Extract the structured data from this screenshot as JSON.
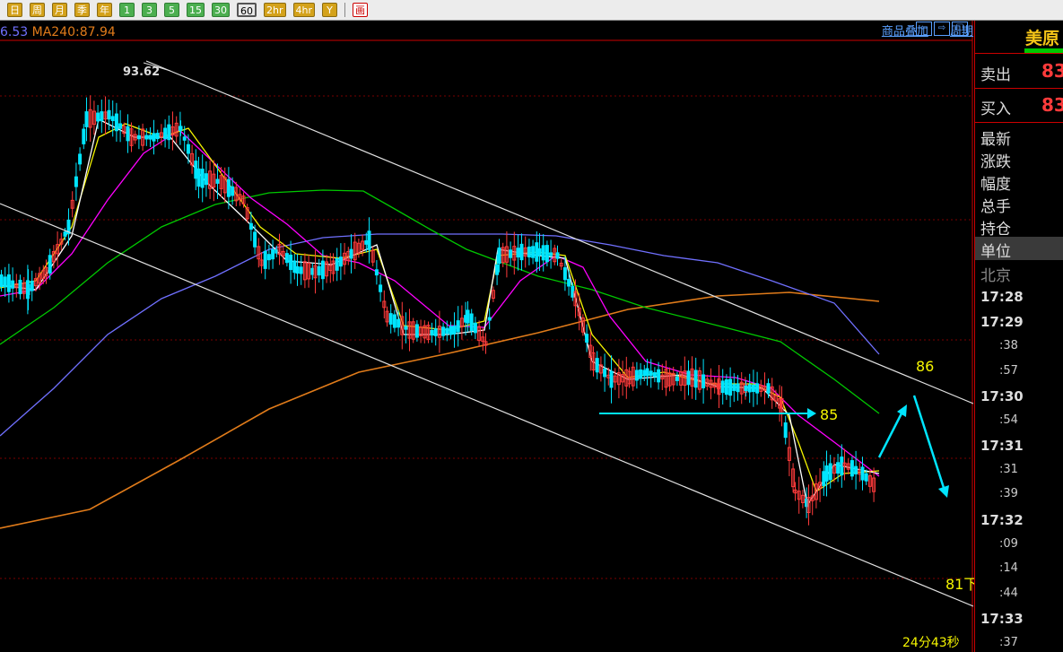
{
  "toolbar": {
    "buttons": [
      "日",
      "周",
      "月",
      "季",
      "年",
      "1",
      "3",
      "5",
      "15",
      "30",
      "60",
      "2hr",
      "4hr",
      "Y"
    ],
    "active": "60"
  },
  "ma_label": {
    "a": "6.53",
    "b": "MA240:87.94"
  },
  "links": {
    "overlay": "商品叠加",
    "period": "周期"
  },
  "nav": [
    "⇦",
    "⇨",
    "☐"
  ],
  "chart_texts": {
    "high": "93.62",
    "t86": "86",
    "t85": "85",
    "t81": "81下",
    "timer": "24分43秒"
  },
  "panel": {
    "title": "美原",
    "sell_label": "卖出",
    "sell_val": "83",
    "buy_label": "买入",
    "buy_val": "83",
    "rows": [
      "最新",
      "涨跌",
      "幅度",
      "总手",
      "持仓"
    ],
    "unit": "单位",
    "city": "北京",
    "times": [
      {
        "t": "17:28",
        "big": true
      },
      {
        "t": "17:29",
        "big": true
      },
      {
        "t": ":38"
      },
      {
        "t": ":57"
      },
      {
        "t": "17:30",
        "big": true
      },
      {
        "t": ":54"
      },
      {
        "t": "17:31",
        "big": true
      },
      {
        "t": ":31"
      },
      {
        "t": ":39"
      },
      {
        "t": "17:32",
        "big": true
      },
      {
        "t": ":09"
      },
      {
        "t": ":14"
      },
      {
        "t": ":44"
      },
      {
        "t": "17:33",
        "big": true
      },
      {
        "t": ":37"
      }
    ]
  },
  "colors": {
    "up": "#ff3b3b",
    "down": "#00e5ff",
    "ma5": "#ffffff",
    "ma10": "#f5f500",
    "ma20": "#ff00ff",
    "ma60": "#00c800",
    "ma120": "#7070ff",
    "ma240": "#e07b1a",
    "annot": "#00e5ff",
    "channel": "#e0e0e0"
  }
}
